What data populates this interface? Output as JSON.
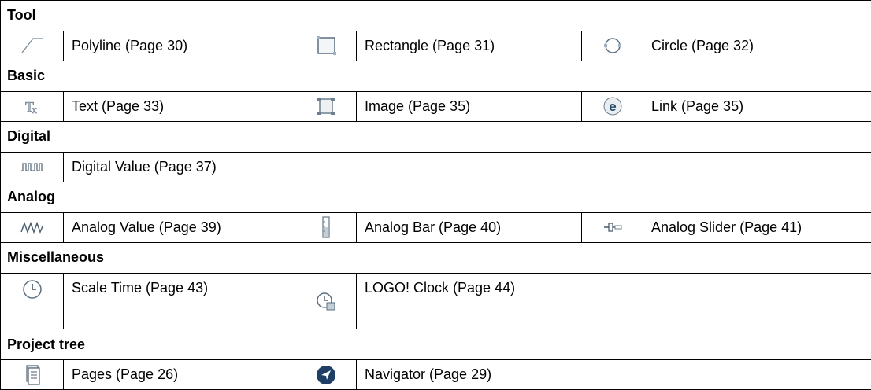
{
  "sections": {
    "tool": "Tool",
    "basic": "Basic",
    "digital": "Digital",
    "analog": "Analog",
    "miscellaneous": "Miscellaneous",
    "project_tree": "Project tree"
  },
  "tool": {
    "polyline": {
      "label": "Polyline (Page 30)",
      "icon": "polyline-icon"
    },
    "rectangle": {
      "label": "Rectangle (Page 31)",
      "icon": "rectangle-icon"
    },
    "circle": {
      "label": "Circle (Page 32)",
      "icon": "circle-icon"
    }
  },
  "basic": {
    "text": {
      "label": "Text (Page 33)",
      "icon": "text-icon"
    },
    "image": {
      "label": "Image (Page 35)",
      "icon": "image-icon"
    },
    "link": {
      "label": "Link (Page 35)",
      "icon": "link-icon"
    }
  },
  "digital": {
    "digital_value": {
      "label": "Digital Value (Page 37)",
      "icon": "digital-value-icon"
    }
  },
  "analog": {
    "analog_value": {
      "label": "Analog Value (Page 39)",
      "icon": "analog-value-icon"
    },
    "analog_bar": {
      "label": "Analog Bar (Page 40)",
      "icon": "analog-bar-icon"
    },
    "analog_slider": {
      "label": "Analog Slider (Page 41)",
      "icon": "analog-slider-icon"
    }
  },
  "miscellaneous": {
    "scale_time": {
      "label": "Scale Time (Page 43)",
      "icon": "clock-icon"
    },
    "logo_clock": {
      "label": "LOGO! Clock (Page 44)",
      "icon": "logo-clock-icon"
    }
  },
  "project_tree": {
    "pages": {
      "label": "Pages (Page 26)",
      "icon": "pages-icon"
    },
    "navigator": {
      "label": "Navigator (Page 29)",
      "icon": "navigator-icon"
    }
  }
}
